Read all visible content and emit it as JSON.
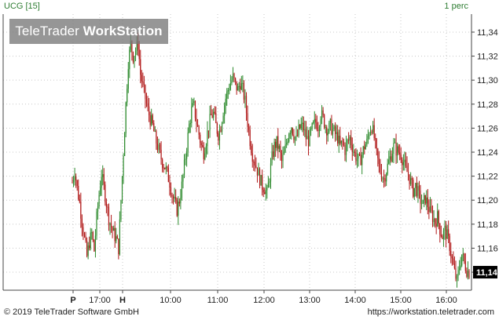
{
  "header": {
    "symbol_label": "UCG [15]",
    "interval_label": "1 perc"
  },
  "watermark": {
    "brand_regular": "TeleTrader ",
    "brand_bold": "WorkStation"
  },
  "footer": {
    "copyright": "© 2019 TeleTrader Software GmbH",
    "url": "https://workstation.teletrader.com"
  },
  "colors": {
    "up": "#2e8b2e",
    "down": "#b01818",
    "grid": "#c8c8c8",
    "axis": "#444444",
    "label_box_bg": "#000000",
    "label_box_text": "#ffffff",
    "header_text": "#2e7d32"
  },
  "chart_data": {
    "type": "candlestick",
    "title": "UCG [15]",
    "interval": "1 perc",
    "grid": true,
    "y_axis_side": "right",
    "ylim": [
      11.125,
      11.355
    ],
    "y_ticks": [
      "11,14",
      "11,16",
      "11,18",
      "11,20",
      "11,22",
      "11,24",
      "11,26",
      "11,28",
      "11,30",
      "11,32",
      "11,34"
    ],
    "y_tick_values": [
      11.14,
      11.16,
      11.18,
      11.2,
      11.22,
      11.24,
      11.26,
      11.28,
      11.3,
      11.32,
      11.34
    ],
    "x_ticks": [
      "P",
      "17:00",
      "H",
      "10:00",
      "11:00",
      "12:00",
      "13:00",
      "14:00",
      "15:00",
      "16:00"
    ],
    "last_value_label": "11,14",
    "last_value": 11.14,
    "price_path": [
      [
        0,
        11.215
      ],
      [
        2,
        11.225
      ],
      [
        4,
        11.21
      ],
      [
        6,
        11.198
      ],
      [
        8,
        11.182
      ],
      [
        10,
        11.168
      ],
      [
        12,
        11.153
      ],
      [
        14,
        11.165
      ],
      [
        16,
        11.172
      ],
      [
        18,
        11.158
      ],
      [
        20,
        11.185
      ],
      [
        22,
        11.205
      ],
      [
        24,
        11.222
      ],
      [
        26,
        11.21
      ],
      [
        28,
        11.198
      ],
      [
        30,
        11.185
      ],
      [
        32,
        11.178
      ],
      [
        34,
        11.172
      ],
      [
        36,
        11.168
      ],
      [
        38,
        11.16
      ],
      [
        40,
        11.2
      ],
      [
        42,
        11.24
      ],
      [
        44,
        11.28
      ],
      [
        46,
        11.315
      ],
      [
        48,
        11.33
      ],
      [
        50,
        11.32
      ],
      [
        52,
        11.325
      ],
      [
        54,
        11.33
      ],
      [
        56,
        11.305
      ],
      [
        58,
        11.295
      ],
      [
        60,
        11.285
      ],
      [
        62,
        11.275
      ],
      [
        64,
        11.268
      ],
      [
        66,
        11.262
      ],
      [
        68,
        11.252
      ],
      [
        70,
        11.245
      ],
      [
        72,
        11.238
      ],
      [
        74,
        11.232
      ],
      [
        76,
        11.228
      ],
      [
        78,
        11.222
      ],
      [
        80,
        11.215
      ],
      [
        82,
        11.205
      ],
      [
        84,
        11.198
      ],
      [
        86,
        11.192
      ],
      [
        88,
        11.2
      ],
      [
        90,
        11.212
      ],
      [
        92,
        11.228
      ],
      [
        94,
        11.245
      ],
      [
        96,
        11.262
      ],
      [
        98,
        11.275
      ],
      [
        100,
        11.278
      ],
      [
        102,
        11.265
      ],
      [
        104,
        11.255
      ],
      [
        106,
        11.245
      ],
      [
        108,
        11.24
      ],
      [
        110,
        11.25
      ],
      [
        112,
        11.262
      ],
      [
        114,
        11.27
      ],
      [
        116,
        11.272
      ],
      [
        118,
        11.262
      ],
      [
        120,
        11.255
      ],
      [
        122,
        11.262
      ],
      [
        124,
        11.275
      ],
      [
        126,
        11.285
      ],
      [
        128,
        11.292
      ],
      [
        130,
        11.298
      ],
      [
        132,
        11.302
      ],
      [
        134,
        11.296
      ],
      [
        136,
        11.292
      ],
      [
        138,
        11.298
      ],
      [
        140,
        11.292
      ],
      [
        142,
        11.282
      ],
      [
        144,
        11.265
      ],
      [
        146,
        11.25
      ],
      [
        148,
        11.238
      ],
      [
        150,
        11.232
      ],
      [
        152,
        11.225
      ],
      [
        154,
        11.218
      ],
      [
        156,
        11.212
      ],
      [
        158,
        11.21
      ],
      [
        160,
        11.205
      ],
      [
        162,
        11.22
      ],
      [
        164,
        11.235
      ],
      [
        166,
        11.245
      ],
      [
        168,
        11.248
      ],
      [
        170,
        11.242
      ],
      [
        172,
        11.232
      ],
      [
        174,
        11.238
      ],
      [
        176,
        11.248
      ],
      [
        178,
        11.258
      ],
      [
        180,
        11.262
      ],
      [
        182,
        11.255
      ],
      [
        184,
        11.25
      ],
      [
        186,
        11.258
      ],
      [
        188,
        11.262
      ],
      [
        190,
        11.26
      ],
      [
        192,
        11.252
      ],
      [
        194,
        11.25
      ],
      [
        196,
        11.256
      ],
      [
        198,
        11.262
      ],
      [
        200,
        11.265
      ],
      [
        202,
        11.262
      ],
      [
        204,
        11.272
      ],
      [
        206,
        11.268
      ],
      [
        208,
        11.262
      ],
      [
        210,
        11.258
      ],
      [
        212,
        11.262
      ],
      [
        214,
        11.258
      ],
      [
        216,
        11.255
      ],
      [
        218,
        11.252
      ],
      [
        220,
        11.245
      ],
      [
        222,
        11.248
      ],
      [
        224,
        11.242
      ],
      [
        226,
        11.248
      ],
      [
        228,
        11.252
      ],
      [
        230,
        11.245
      ],
      [
        232,
        11.238
      ],
      [
        234,
        11.235
      ],
      [
        236,
        11.232
      ],
      [
        238,
        11.238
      ],
      [
        240,
        11.245
      ],
      [
        242,
        11.248
      ],
      [
        244,
        11.258
      ],
      [
        246,
        11.262
      ],
      [
        248,
        11.252
      ],
      [
        250,
        11.238
      ],
      [
        252,
        11.228
      ],
      [
        254,
        11.222
      ],
      [
        256,
        11.218
      ],
      [
        258,
        11.225
      ],
      [
        260,
        11.232
      ],
      [
        262,
        11.238
      ],
      [
        264,
        11.245
      ],
      [
        266,
        11.242
      ],
      [
        268,
        11.24
      ],
      [
        270,
        11.238
      ],
      [
        272,
        11.232
      ],
      [
        274,
        11.225
      ],
      [
        276,
        11.222
      ],
      [
        278,
        11.215
      ],
      [
        280,
        11.208
      ],
      [
        282,
        11.212
      ],
      [
        284,
        11.206
      ],
      [
        286,
        11.2
      ],
      [
        288,
        11.196
      ],
      [
        290,
        11.202
      ],
      [
        292,
        11.196
      ],
      [
        294,
        11.19
      ],
      [
        296,
        11.186
      ],
      [
        298,
        11.182
      ],
      [
        300,
        11.186
      ],
      [
        302,
        11.176
      ],
      [
        304,
        11.17
      ],
      [
        306,
        11.175
      ],
      [
        308,
        11.17
      ],
      [
        310,
        11.162
      ],
      [
        312,
        11.15
      ],
      [
        314,
        11.14
      ],
      [
        316,
        11.132
      ],
      [
        318,
        11.145
      ],
      [
        320,
        11.155
      ],
      [
        322,
        11.148
      ],
      [
        324,
        11.142
      ],
      [
        326,
        11.14
      ]
    ]
  }
}
